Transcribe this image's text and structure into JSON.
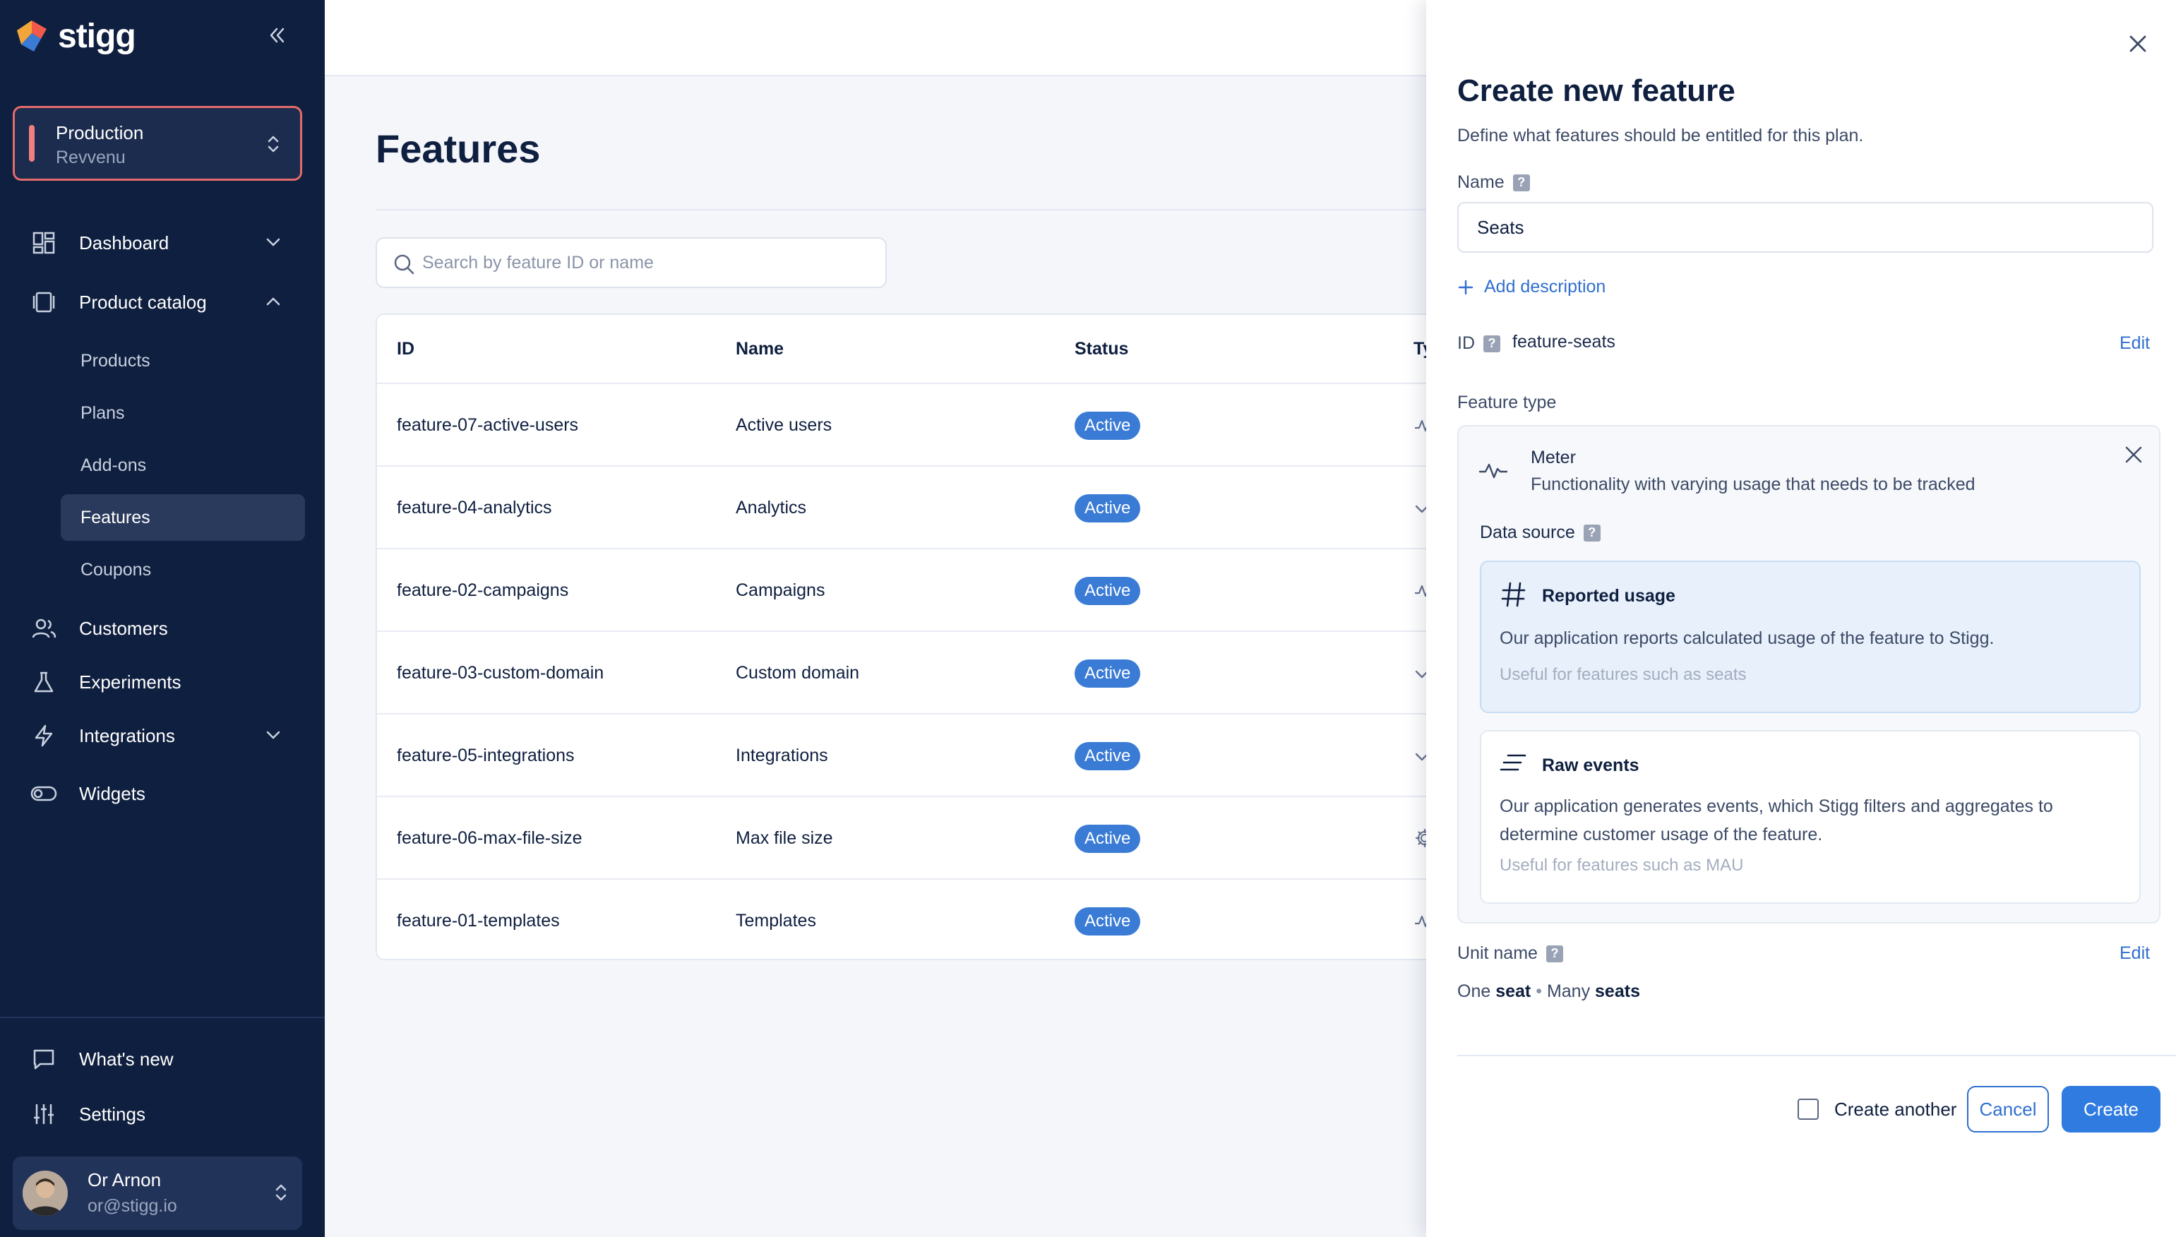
{
  "brand": {
    "name": "stigg"
  },
  "environment": {
    "name": "Production",
    "account": "Revvenu"
  },
  "nav": {
    "dashboard": "Dashboard",
    "product_catalog": "Product catalog",
    "sub_items": [
      "Products",
      "Plans",
      "Add-ons",
      "Features",
      "Coupons"
    ],
    "customers": "Customers",
    "experiments": "Experiments",
    "integrations": "Integrations",
    "widgets": "Widgets",
    "whats_new": "What's new",
    "settings": "Settings"
  },
  "user": {
    "name": "Or Arnon",
    "email": "or@stigg.io"
  },
  "main": {
    "title": "Features",
    "search_placeholder": "Search by feature ID or name",
    "columns": [
      "ID",
      "Name",
      "Status",
      "Typ"
    ],
    "rows": [
      {
        "id": "feature-07-active-users",
        "name": "Active users",
        "status": "Active",
        "type_icon": "meter-hash-icon"
      },
      {
        "id": "feature-04-analytics",
        "name": "Analytics",
        "status": "Active",
        "type_icon": "check-icon"
      },
      {
        "id": "feature-02-campaigns",
        "name": "Campaigns",
        "status": "Active",
        "type_icon": "meter-hash-icon"
      },
      {
        "id": "feature-03-custom-domain",
        "name": "Custom domain",
        "status": "Active",
        "type_icon": "check-icon"
      },
      {
        "id": "feature-05-integrations",
        "name": "Integrations",
        "status": "Active",
        "type_icon": "check-icon"
      },
      {
        "id": "feature-06-max-file-size",
        "name": "Max file size",
        "status": "Active",
        "type_icon": "config-gear-icon"
      },
      {
        "id": "feature-01-templates",
        "name": "Templates",
        "status": "Active",
        "type_icon": "meter-hash-icon"
      }
    ]
  },
  "panel": {
    "title": "Create new feature",
    "subtitle": "Define what features should be entitled for this plan.",
    "name_label": "Name",
    "name_value": "Seats",
    "add_description": "Add description",
    "id_label": "ID",
    "id_value": "feature-seats",
    "edit": "Edit",
    "feature_type_label": "Feature type",
    "feature_type": {
      "name": "Meter",
      "description": "Functionality with varying usage that needs to be tracked"
    },
    "data_source_label": "Data source",
    "data_sources": [
      {
        "title": "Reported usage",
        "text": "Our application reports calculated usage of the feature to Stigg.",
        "hint": "Useful for features such as seats",
        "selected": true
      },
      {
        "title": "Raw events",
        "text": "Our application generates events, which Stigg filters and aggregates to determine customer usage of the feature.",
        "hint": "Useful for features such as MAU",
        "selected": false
      }
    ],
    "unit_name_label": "Unit name",
    "unit": {
      "one_prefix": "One",
      "singular": "seat",
      "sep": "•",
      "many_prefix": "Many",
      "plural": "seats"
    },
    "create_another": "Create another",
    "cancel": "Cancel",
    "create": "Create"
  },
  "colors": {
    "sidebar_bg": "#0f1f3f",
    "accent": "#2f7be0",
    "badge": "#3a7bd5",
    "env_border": "#e46b6b"
  }
}
